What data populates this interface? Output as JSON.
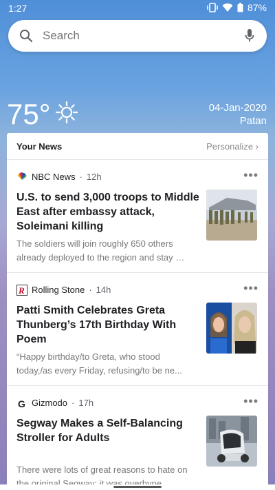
{
  "status": {
    "time": "1:27",
    "battery": "87%"
  },
  "search": {
    "placeholder": "Search"
  },
  "weather": {
    "temp": "75°",
    "date": "04-Jan-2020",
    "place": "Patan"
  },
  "feed": {
    "title": "Your News",
    "personalize": "Personalize ›",
    "more": "•••",
    "cards": [
      {
        "source": "NBC News",
        "age": "12h",
        "headline": "U.S. to send 3,000 troops to Middle East after embassy attack, Soleimani killing",
        "snippet": "The soldiers will join roughly 650 others already deployed to the region and stay …"
      },
      {
        "source": "Rolling Stone",
        "age": "14h",
        "headline": "Patti Smith Celebrates Greta Thunberg’s 17th Birthday With Poem",
        "snippet": "“Happy birthday/to Greta, who stood today,/as every Friday, refusing/to be ne..."
      },
      {
        "source": "Gizmodo",
        "age": "17h",
        "headline": "Segway Makes a Self-Balancing Stroller for Adults",
        "snippet": "There were lots of great reasons to hate on the original Segway: it was overhype…"
      }
    ]
  }
}
